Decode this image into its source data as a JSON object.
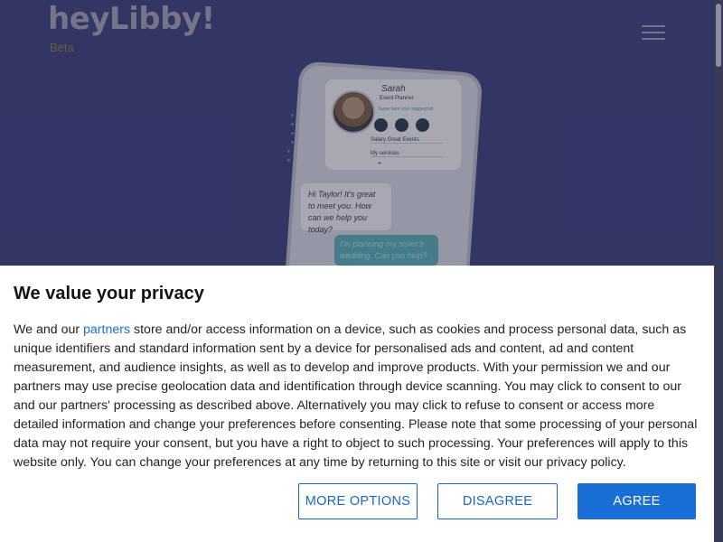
{
  "site": {
    "logo_text": "heyLibby!",
    "beta_label": "Beta",
    "menu_icon": "hamburger-menu-icon"
  },
  "phone_mockup": {
    "profile_name": "Sarah",
    "profile_role": "Event Planner",
    "profile_link": "Tease here your suggestion",
    "row_1": "Salary Great Events",
    "row_2": "My services",
    "chat_incoming": "Hi Taylor! It's great to meet you. How can we help you today?",
    "chat_outgoing": "I'm planning my sister's wedding. Can you help?"
  },
  "consent": {
    "title": "We value your privacy",
    "text_before_link": "We and our ",
    "partners_link": "partners",
    "text_after_link": " store and/or access information on a device, such as cookies and process personal data, such as unique identifiers and standard information sent by a device for personalised ads and content, ad and content measurement, and audience insights, as well as to develop and improve products. With your permission we and our partners may use precise geolocation data and identification through device scanning. You may click to consent to our and our partners' processing as described above. Alternatively you may click to refuse to consent or access more detailed information and change your preferences before consenting. Please note that some processing of your personal data may not require your consent, but you have a right to object to such processing. Your preferences will apply to this website only. You can change your preferences at any time by returning to this site or visit our privacy policy.",
    "buttons": {
      "more_options": "MORE OPTIONS",
      "disagree": "DISAGREE",
      "agree": "AGREE"
    }
  },
  "colors": {
    "hero_bg": "#3f417c",
    "accent_blue": "#1a6fd6"
  }
}
